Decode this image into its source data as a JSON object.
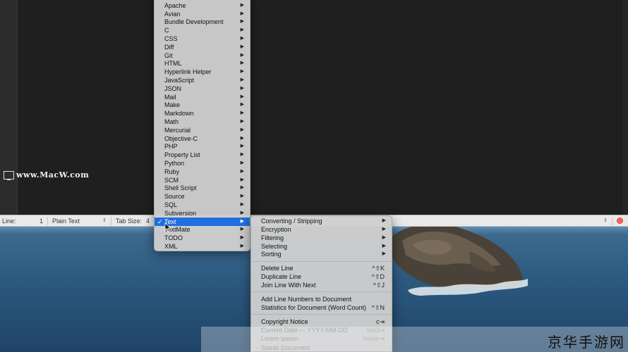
{
  "watermark": {
    "site": "www.MacW.com"
  },
  "statusbar": {
    "line_label": "Line:",
    "line_value": "1",
    "language": "Plain Text",
    "tab_size_label": "Tab Size:",
    "tab_size_value": "4"
  },
  "bundle_menu": {
    "items": [
      {
        "label": "Apache"
      },
      {
        "label": "Avian"
      },
      {
        "label": "Bundle Development"
      },
      {
        "label": "C"
      },
      {
        "label": "CSS"
      },
      {
        "label": "Diff"
      },
      {
        "label": "Git"
      },
      {
        "label": "HTML"
      },
      {
        "label": "Hyperlink Helper"
      },
      {
        "label": "JavaScript"
      },
      {
        "label": "JSON"
      },
      {
        "label": "Mail"
      },
      {
        "label": "Make"
      },
      {
        "label": "Markdown"
      },
      {
        "label": "Math"
      },
      {
        "label": "Mercurial"
      },
      {
        "label": "Objective-C"
      },
      {
        "label": "PHP"
      },
      {
        "label": "Property List"
      },
      {
        "label": "Python"
      },
      {
        "label": "Ruby"
      },
      {
        "label": "SCM"
      },
      {
        "label": "Shell Script"
      },
      {
        "label": "Source"
      },
      {
        "label": "SQL"
      },
      {
        "label": "Subversion"
      },
      {
        "label": "Text"
      },
      {
        "label": "TextMate"
      },
      {
        "label": "TODO"
      },
      {
        "label": "XML"
      }
    ],
    "selected": "Text",
    "check_mark": "✓",
    "arrow": "▶"
  },
  "text_submenu": {
    "group1": [
      {
        "label": "Converting / Stripping"
      },
      {
        "label": "Encryption"
      },
      {
        "label": "Filtering"
      },
      {
        "label": "Selecting"
      },
      {
        "label": "Sorting"
      }
    ],
    "group2": [
      {
        "label": "Delete Line",
        "shortcut": "^⇧K"
      },
      {
        "label": "Duplicate Line",
        "shortcut": "^⇧D"
      },
      {
        "label": "Join Line With Next",
        "shortcut": "^⇧J"
      }
    ],
    "group3": [
      {
        "label": "Add Line Numbers to Document",
        "shortcut": ""
      },
      {
        "label": "Statistics for Document (Word Count)",
        "shortcut": "^⇧N"
      }
    ],
    "group4": [
      {
        "label": "Copyright Notice",
        "shortcut": "c⇥"
      },
      {
        "label": "Current Date — YYYY-MM-DD",
        "shortcut": "isoD⇥"
      },
      {
        "label": "Lorem ipsum",
        "shortcut": "lorem⇥"
      },
      {
        "label": "Speak Document",
        "shortcut": ""
      }
    ]
  },
  "brand": {
    "text": "京华手游网"
  }
}
